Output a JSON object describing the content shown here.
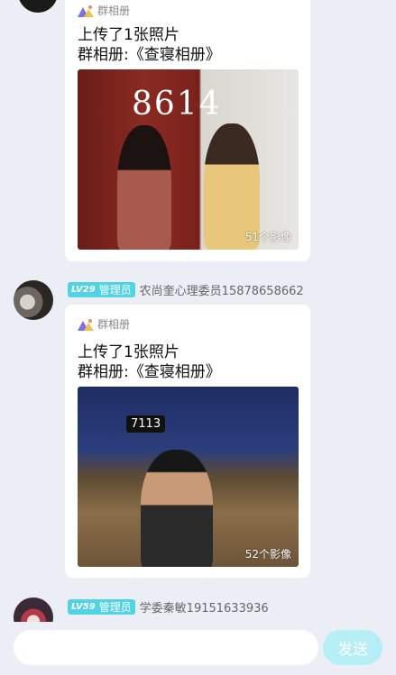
{
  "messages": [
    {
      "sender": null,
      "album_label": "群相册",
      "line1": "上传了1张照片",
      "line2": "群相册:《查寝相册》",
      "photo_tag": "8614",
      "photo_count": "51个影像"
    },
    {
      "sender": {
        "level": "LV29",
        "role": "管理员",
        "name": "农尚奎心理委员15878658662"
      },
      "album_label": "群相册",
      "line1": "上传了1张照片",
      "line2": "群相册:《查寝相册》",
      "photo_tag": "7113",
      "photo_count": "52个影像"
    },
    {
      "sender": {
        "level": "LV59",
        "role": "管理员",
        "name": "学委秦敏19151633936"
      }
    }
  ],
  "input": {
    "placeholder": ""
  },
  "send_label": "发送",
  "colors": {
    "badge": "#52d3e3",
    "send_button": "#b6eef5",
    "background": "#eceef5"
  }
}
